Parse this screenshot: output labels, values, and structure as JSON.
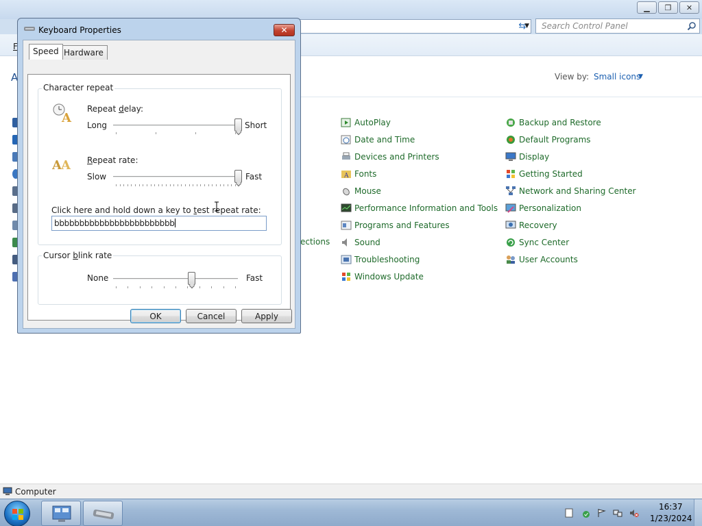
{
  "control_panel": {
    "search_placeholder": "Search Control Panel",
    "menu_first_letter": "F",
    "heading_stub": "A",
    "view_by_label": "View by:",
    "view_by_value": "Small icons",
    "hidden_item_stub": "ections",
    "items_col1": [
      {
        "label": "AutoPlay",
        "icon": "autoplay-icon"
      },
      {
        "label": "Date and Time",
        "icon": "clock-icon"
      },
      {
        "label": "Devices and Printers",
        "icon": "printer-icon"
      },
      {
        "label": "Fonts",
        "icon": "fonts-folder-icon"
      },
      {
        "label": "Mouse",
        "icon": "mouse-icon"
      },
      {
        "label": "Performance Information and Tools",
        "icon": "performance-icon"
      },
      {
        "label": "Programs and Features",
        "icon": "programs-icon"
      },
      {
        "label": "Sound",
        "icon": "speaker-icon"
      },
      {
        "label": "Troubleshooting",
        "icon": "troubleshooting-icon"
      },
      {
        "label": "Windows Update",
        "icon": "windows-update-icon"
      }
    ],
    "items_col2": [
      {
        "label": "Backup and Restore",
        "icon": "backup-icon"
      },
      {
        "label": "Default Programs",
        "icon": "default-programs-icon"
      },
      {
        "label": "Display",
        "icon": "display-icon"
      },
      {
        "label": "Getting Started",
        "icon": "getting-started-icon"
      },
      {
        "label": "Network and Sharing Center",
        "icon": "network-icon"
      },
      {
        "label": "Personalization",
        "icon": "personalization-icon"
      },
      {
        "label": "Recovery",
        "icon": "recovery-icon"
      },
      {
        "label": "Sync Center",
        "icon": "sync-icon"
      },
      {
        "label": "User Accounts",
        "icon": "users-icon"
      }
    ],
    "status_text": "Computer"
  },
  "dialog": {
    "title": "Keyboard Properties",
    "close_glyph": "✕",
    "tabs": [
      "Speed",
      "Hardware"
    ],
    "char_repeat": {
      "group_label": "Character repeat",
      "delay_label_pre": "Repeat ",
      "delay_label_u": "d",
      "delay_label_post": "elay:",
      "delay_min": "Long",
      "delay_max": "Short",
      "delay_value": 1.0,
      "rate_label_u": "R",
      "rate_label_post": "epeat rate:",
      "rate_min": "Slow",
      "rate_max": "Fast",
      "rate_value": 1.0,
      "test_label_pre": "Click here and hold down a key to ",
      "test_label_u": "t",
      "test_label_post": "est repeat rate:",
      "test_value": "bbbbbbbbbbbbbbbbbbbbbbbb"
    },
    "cursor_blink": {
      "group_label_pre": "Cursor ",
      "group_label_u": "b",
      "group_label_post": "link rate",
      "min": "None",
      "max": "Fast",
      "value": 0.63
    },
    "buttons": {
      "ok": "OK",
      "cancel": "Cancel",
      "apply": "Apply"
    }
  },
  "taskbar": {
    "time": "16:37",
    "date": "1/23/2024"
  },
  "colors": {
    "link_green": "#1e6a2a",
    "link_blue": "#1b5fb0",
    "close_red": "#c2422f"
  }
}
